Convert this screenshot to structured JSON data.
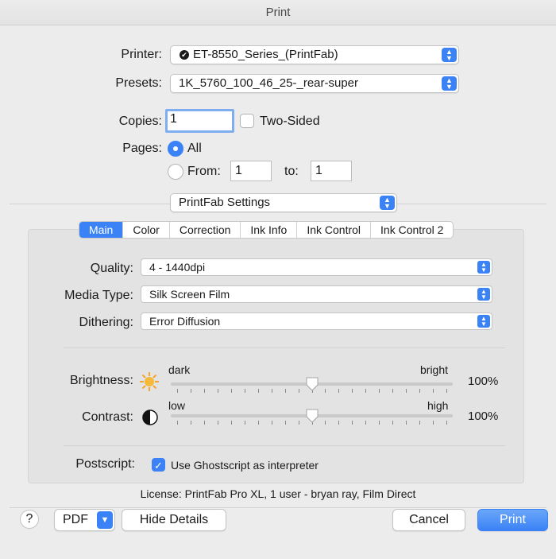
{
  "window": {
    "title": "Print"
  },
  "printer": {
    "label": "Printer:",
    "value": "ET-8550_Series_(PrintFab)"
  },
  "presets": {
    "label": "Presets:",
    "value": "1K_5760_100_46_25-_rear-super"
  },
  "copies": {
    "label": "Copies:",
    "value": "1",
    "two_sided_label": "Two-Sided",
    "two_sided_checked": false
  },
  "pages": {
    "label": "Pages:",
    "all_label": "All",
    "from_label": "From:",
    "from_value": "1",
    "to_label": "to:",
    "to_value": "1",
    "selected": "All"
  },
  "section_popup": {
    "value": "PrintFab Settings"
  },
  "tabs": [
    {
      "label": "Main",
      "active": true
    },
    {
      "label": "Color",
      "active": false
    },
    {
      "label": "Correction",
      "active": false
    },
    {
      "label": "Ink Info",
      "active": false
    },
    {
      "label": "Ink Control",
      "active": false
    },
    {
      "label": "Ink Control 2",
      "active": false
    }
  ],
  "settings": {
    "quality": {
      "label": "Quality:",
      "value": "4 - 1440dpi"
    },
    "media_type": {
      "label": "Media Type:",
      "value": "Silk Screen Film"
    },
    "dithering": {
      "label": "Dithering:",
      "value": "Error Diffusion"
    }
  },
  "brightness": {
    "label": "Brightness:",
    "min_label": "dark",
    "max_label": "bright",
    "value_text": "100%",
    "level": 0.5,
    "icon": "sun-icon"
  },
  "contrast": {
    "label": "Contrast:",
    "min_label": "low",
    "max_label": "high",
    "value_text": "100%",
    "level": 0.5,
    "icon": "contrast-icon"
  },
  "postscript": {
    "label": "Postscript:",
    "checkbox_label": "Use Ghostscript as interpreter",
    "checked": true
  },
  "license": "License: PrintFab Pro XL, 1 user - bryan ray, Film Direct",
  "footer": {
    "help": "?",
    "pdf_label": "PDF",
    "hide_details_label": "Hide Details",
    "cancel_label": "Cancel",
    "print_label": "Print"
  },
  "colors": {
    "accent": "#3b82f6"
  }
}
